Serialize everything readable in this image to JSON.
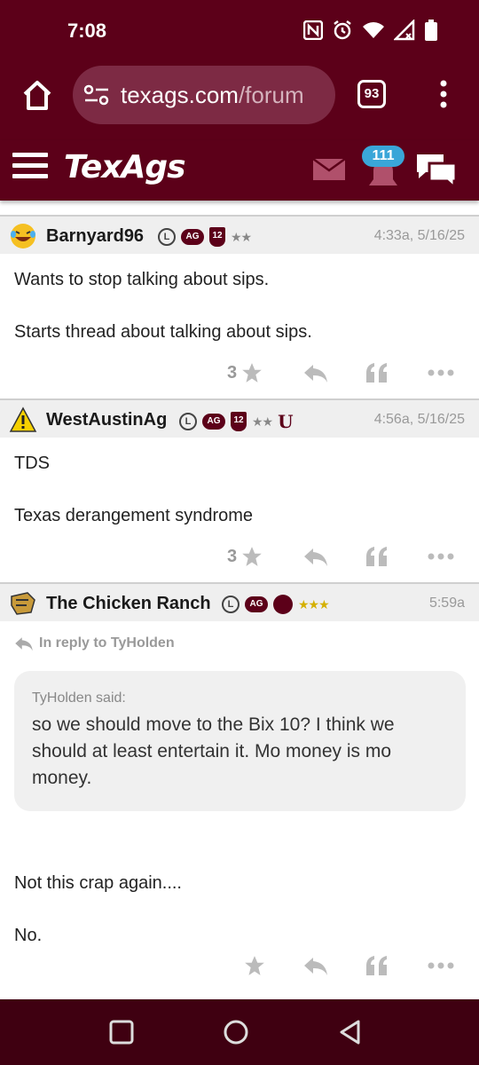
{
  "status": {
    "time": "7:08",
    "icons": [
      "nfc-icon",
      "alarm-icon",
      "wifi-icon",
      "signal-icon",
      "battery-icon"
    ]
  },
  "browser": {
    "url_domain": "texags.com",
    "url_path": "/forum",
    "tab_count": "93"
  },
  "site": {
    "logo": "TexAgs",
    "notification_count": "111"
  },
  "posts": [
    {
      "username": "Barnyard96",
      "badges": [
        "L",
        "AG",
        "12",
        "★★"
      ],
      "time": "4:33a, 5/16/25",
      "body": [
        "Wants to stop talking about sips.",
        "Starts thread about talking about sips."
      ],
      "star_count": "3"
    },
    {
      "username": "WestAustinAg",
      "badges": [
        "L",
        "AG",
        "12",
        "★★",
        "U"
      ],
      "time": "4:56a, 5/16/25",
      "body": [
        "TDS",
        "Texas derangement syndrome"
      ],
      "star_count": "3"
    },
    {
      "username": "The Chicken Ranch",
      "badges": [
        "L",
        "AG",
        "★★★"
      ],
      "time": "5:59a",
      "reply_to": "In reply to TyHolden",
      "quote_author": "TyHolden said:",
      "quote_text": "so we should move to the Bix 10? I think we should at least entertain it. Mo money is mo money.",
      "body": [
        "Not this crap again....",
        "No."
      ],
      "star_count": ""
    }
  ],
  "colors": {
    "maroon": "#5c0019",
    "badge_blue": "#3aa6d8",
    "gold_star": "#d4b000"
  }
}
